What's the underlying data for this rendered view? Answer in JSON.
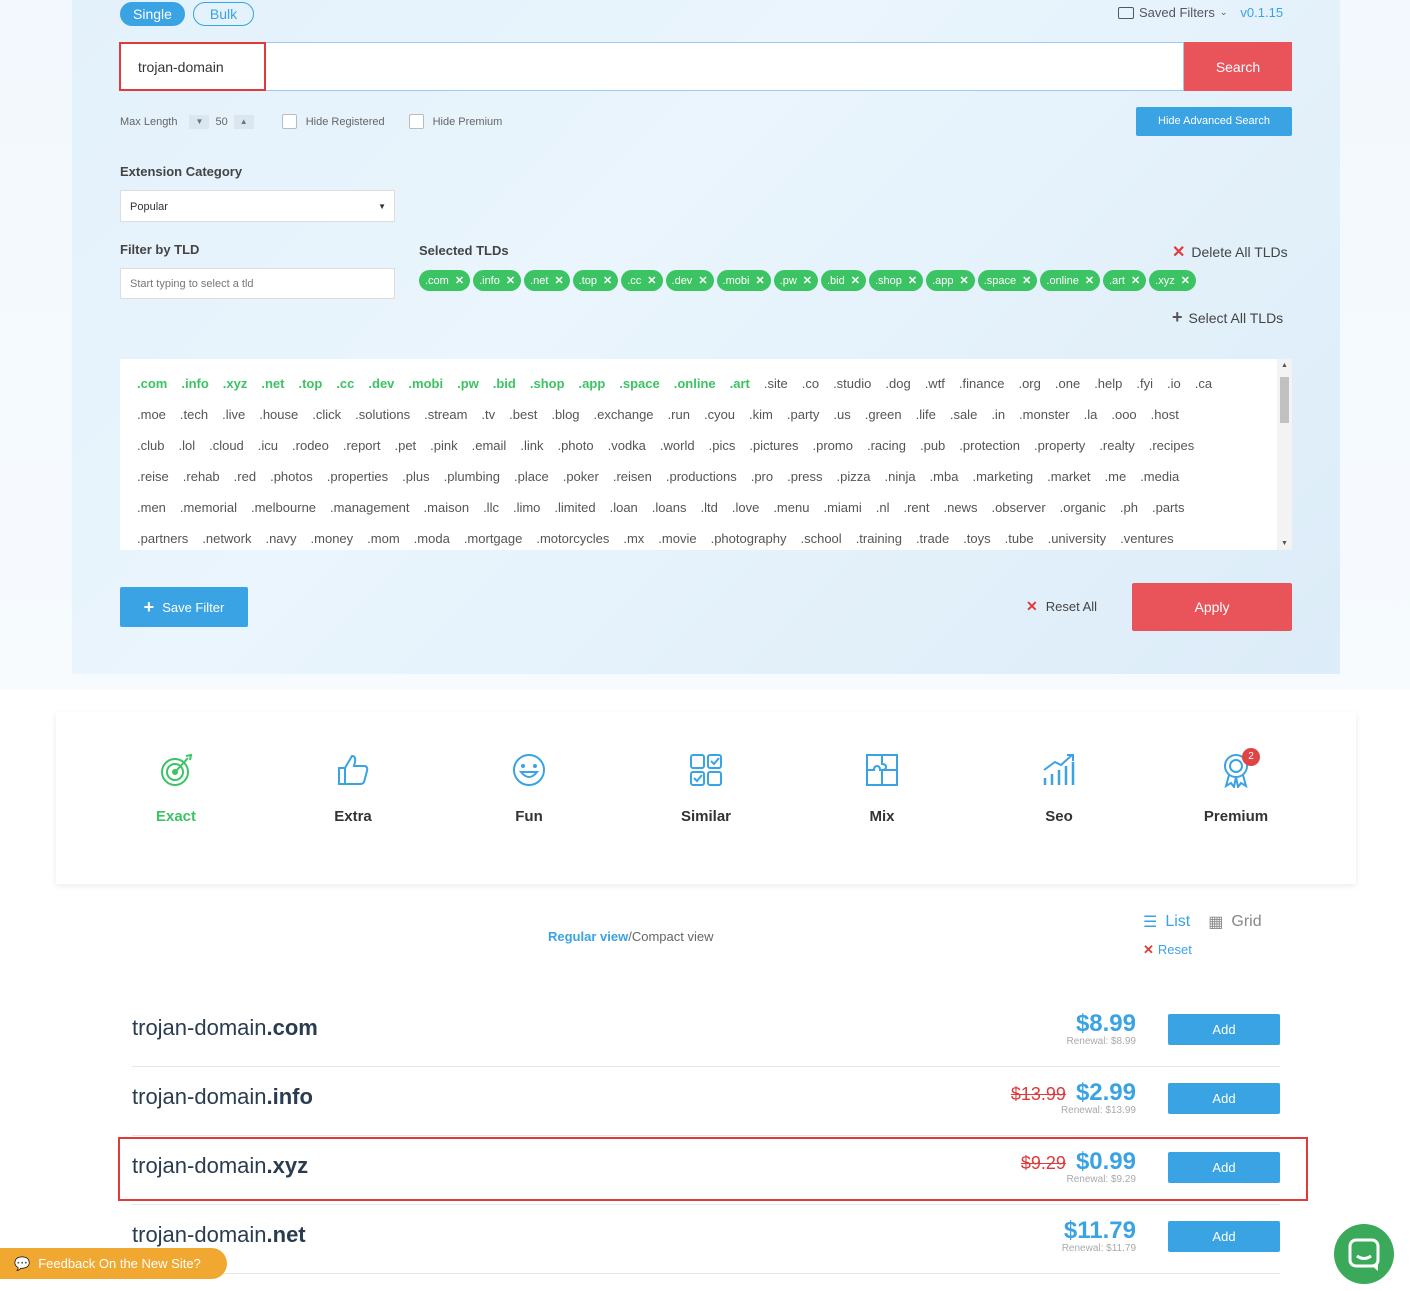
{
  "mode": {
    "single": "Single",
    "bulk": "Bulk"
  },
  "header": {
    "saved_filters": "Saved Filters",
    "version": "v0.1.15"
  },
  "search": {
    "value": "trojan-domain",
    "button": "Search"
  },
  "options": {
    "max_length_label": "Max Length",
    "max_length_value": "50",
    "hide_registered": "Hide Registered",
    "hide_premium": "Hide Premium",
    "advanced_button": "Hide Advanced Search"
  },
  "extension_category": {
    "label": "Extension Category",
    "selected": "Popular"
  },
  "filter_tld": {
    "label": "Filter by TLD",
    "placeholder": "Start typing to select a tld"
  },
  "selected_tlds": {
    "label": "Selected TLDs",
    "delete_all": "Delete All TLDs",
    "select_all": "Select All TLDs",
    "chips": [
      ".com",
      ".info",
      ".net",
      ".top",
      ".cc",
      ".dev",
      ".mobi",
      ".pw",
      ".bid",
      ".shop",
      ".app",
      ".space",
      ".online",
      ".art",
      ".xyz"
    ]
  },
  "tld_list": {
    "rows": [
      [
        ".com",
        ".info",
        ".xyz",
        ".net",
        ".top",
        ".cc",
        ".dev",
        ".mobi",
        ".pw",
        ".bid",
        ".shop",
        ".app",
        ".space",
        ".online",
        ".art",
        ".site",
        ".co",
        ".studio",
        ".dog",
        ".wtf",
        ".finance",
        ".org",
        ".one",
        ".help",
        ".fyi",
        ".io",
        ".ca"
      ],
      [
        ".moe",
        ".tech",
        ".live",
        ".house",
        ".click",
        ".solutions",
        ".stream",
        ".tv",
        ".best",
        ".blog",
        ".exchange",
        ".run",
        ".cyou",
        ".kim",
        ".party",
        ".us",
        ".green",
        ".life",
        ".sale",
        ".in",
        ".monster",
        ".la",
        ".ooo",
        ".host"
      ],
      [
        ".club",
        ".lol",
        ".cloud",
        ".icu",
        ".rodeo",
        ".report",
        ".pet",
        ".pink",
        ".email",
        ".link",
        ".photo",
        ".vodka",
        ".world",
        ".pics",
        ".pictures",
        ".promo",
        ".racing",
        ".pub",
        ".protection",
        ".property",
        ".realty",
        ".recipes"
      ],
      [
        ".reise",
        ".rehab",
        ".red",
        ".photos",
        ".properties",
        ".plus",
        ".plumbing",
        ".place",
        ".poker",
        ".reisen",
        ".productions",
        ".pro",
        ".press",
        ".pizza",
        ".ninja",
        ".mba",
        ".marketing",
        ".market",
        ".me",
        ".media"
      ],
      [
        ".men",
        ".memorial",
        ".melbourne",
        ".management",
        ".maison",
        ".llc",
        ".limo",
        ".limited",
        ".loan",
        ".loans",
        ".ltd",
        ".love",
        ".menu",
        ".miami",
        ".nl",
        ".rent",
        ".news",
        ".observer",
        ".organic",
        ".ph",
        ".parts"
      ],
      [
        ".partners",
        ".network",
        ".navy",
        ".money",
        ".mom",
        ".moda",
        ".mortgage",
        ".motorcycles",
        ".mx",
        ".movie",
        ".photography",
        ".school",
        ".training",
        ".trade",
        ".toys",
        ".tube",
        ".university",
        ".ventures"
      ]
    ],
    "selected": [
      ".com",
      ".info",
      ".xyz",
      ".net",
      ".top",
      ".cc",
      ".dev",
      ".mobi",
      ".pw",
      ".bid",
      ".shop",
      ".app",
      ".space",
      ".online",
      ".art"
    ]
  },
  "actions": {
    "save_filter": "Save Filter",
    "reset_all": "Reset All",
    "apply": "Apply"
  },
  "categories": [
    {
      "label": "Exact",
      "icon": "target-icon"
    },
    {
      "label": "Extra",
      "icon": "thumbs-up-icon"
    },
    {
      "label": "Fun",
      "icon": "smiley-icon"
    },
    {
      "label": "Similar",
      "icon": "grid-check-icon"
    },
    {
      "label": "Mix",
      "icon": "puzzle-icon"
    },
    {
      "label": "Seo",
      "icon": "chart-icon"
    },
    {
      "label": "Premium",
      "icon": "award-icon",
      "badge": "2"
    }
  ],
  "view": {
    "regular": "Regular view",
    "separator": "/",
    "compact": "Compact view",
    "list": "List",
    "grid": "Grid",
    "reset": "Reset"
  },
  "results": [
    {
      "name": "trojan-domain",
      "tld": ".com",
      "old_price": "",
      "price": "$8.99",
      "renewal": "Renewal: $8.99",
      "add": "Add"
    },
    {
      "name": "trojan-domain",
      "tld": ".info",
      "old_price": "$13.99",
      "price": "$2.99",
      "renewal": "Renewal: $13.99",
      "add": "Add"
    },
    {
      "name": "trojan-domain",
      "tld": ".xyz",
      "old_price": "$9.29",
      "price": "$0.99",
      "renewal": "Renewal: $9.29",
      "add": "Add"
    },
    {
      "name": "trojan-domain",
      "tld": ".net",
      "old_price": "",
      "price": "$11.79",
      "renewal": "Renewal: $11.79",
      "add": "Add"
    }
  ],
  "feedback": "Feedback On the New Site?",
  "colors": {
    "accent": "#3aa3e3",
    "danger": "#e9545a",
    "success": "#3cc363",
    "feedback": "#f0a830"
  }
}
